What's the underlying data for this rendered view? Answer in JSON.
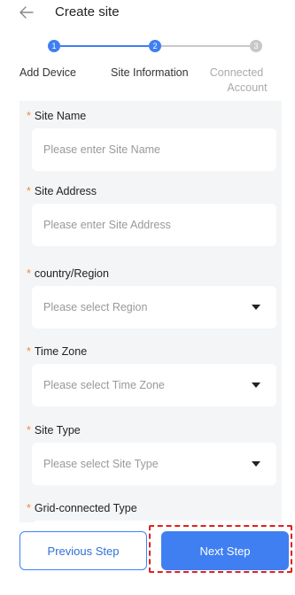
{
  "header": {
    "title": "Create site",
    "back_icon": "arrow-left-icon"
  },
  "stepper": {
    "steps": [
      {
        "number": "1",
        "label": "Add Device",
        "state": "done"
      },
      {
        "number": "2",
        "label": "Site Information",
        "state": "active"
      },
      {
        "number": "3",
        "label_line1": "Connected",
        "label_line2": "Account",
        "state": "pending"
      }
    ],
    "active_color": "#3f7ff1",
    "pending_color": "#c8c8c8"
  },
  "form": {
    "site_name": {
      "label": "Site Name",
      "placeholder": "Please enter Site Name"
    },
    "site_address": {
      "label": "Site Address",
      "placeholder": "Please enter Site Address"
    },
    "region": {
      "label": "country/Region",
      "placeholder": "Please select Region"
    },
    "time_zone": {
      "label": "Time Zone",
      "placeholder": "Please select Time Zone"
    },
    "site_type": {
      "label": "Site Type",
      "placeholder": "Please select Site Type"
    },
    "grid_type": {
      "label": "Grid-connected Type"
    },
    "required_mark": "*",
    "required_color": "#f08a3c"
  },
  "footer": {
    "previous_label": "Previous Step",
    "next_label": "Next Step",
    "primary_color": "#3f7ff1",
    "highlight_color": "#e02020"
  }
}
